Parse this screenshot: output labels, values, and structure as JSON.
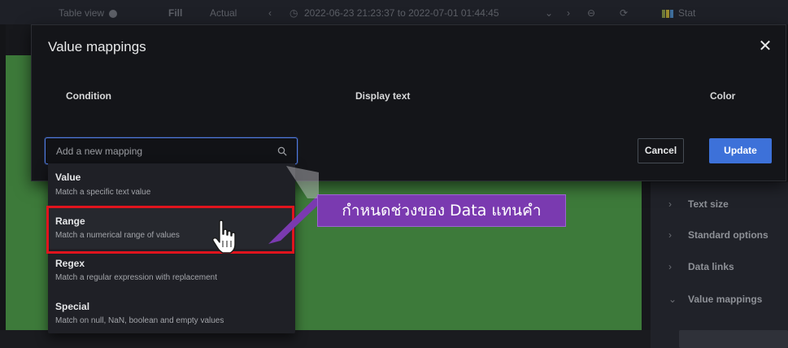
{
  "topbar": {
    "table_view_label": "Table view",
    "fill_label": "Fill",
    "actual_label": "Actual",
    "time_range": "2022-06-23 21:23:37 to 2022-07-01 01:44:45",
    "visualization_label": "Stat"
  },
  "options_pane": {
    "items": [
      {
        "label": "Text size"
      },
      {
        "label": "Standard options"
      },
      {
        "label": "Data links"
      },
      {
        "label": "Value mappings"
      }
    ]
  },
  "modal": {
    "title": "Value mappings",
    "columns": {
      "condition": "Condition",
      "display_text": "Display text",
      "color": "Color"
    },
    "search": {
      "placeholder": "Add a new mapping"
    },
    "cancel_label": "Cancel",
    "update_label": "Update",
    "accent_color": "#3d71d9"
  },
  "dropdown": {
    "options": [
      {
        "label": "Value",
        "description": "Match a specific text value"
      },
      {
        "label": "Range",
        "description": "Match a numerical range of values"
      },
      {
        "label": "Regex",
        "description": "Match a regular expression with replacement"
      },
      {
        "label": "Special",
        "description": "Match on null, NaN, boolean and empty values"
      }
    ],
    "highlighted": "Range",
    "highlight_color": "#e0141d"
  },
  "annotation": {
    "text": "กำหนดช่วงของ Data แทนคำ",
    "color": "#7a3ab0"
  }
}
